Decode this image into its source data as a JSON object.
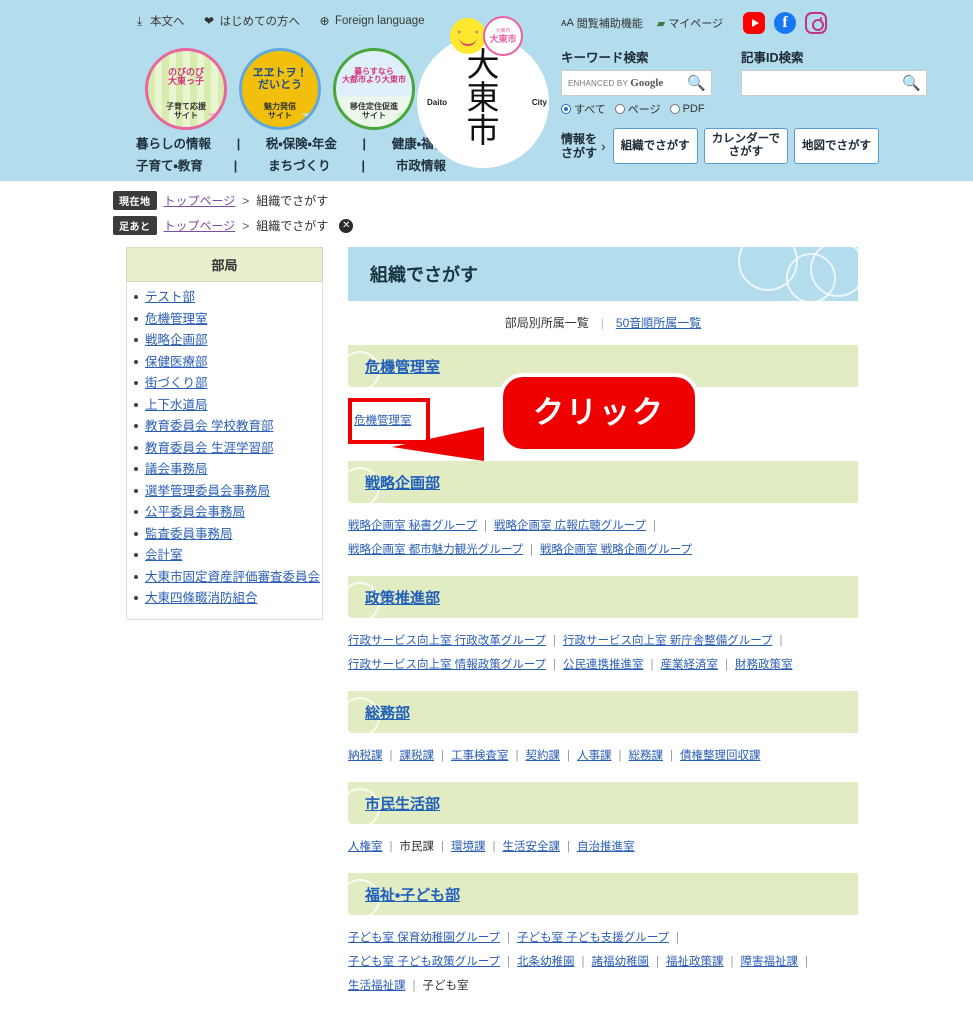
{
  "header": {
    "util_links": [
      {
        "icon": "download-icon",
        "glyph": "⤓",
        "label": "本文へ"
      },
      {
        "icon": "shield-icon",
        "glyph": "❤",
        "label": "はじめての方へ"
      },
      {
        "icon": "globe-icon",
        "glyph": "🌐",
        "label": "Foreign language"
      }
    ],
    "bubbles": [
      {
        "art": "のびのび\n大東っ子",
        "caption": "子育て応援\nサイト",
        "art_line1": "のびのび",
        "art_line2": "大東っ子",
        "cap_line1": "子育て応援",
        "cap_line2": "サイト"
      },
      {
        "art_line1": "ヱヱトヲ！",
        "art_line2": "だいとう",
        "cap_line1": "魅力発信",
        "cap_line2": "サイト"
      },
      {
        "art_line1": "暮らすなら",
        "art_line2": "大都市より大東市",
        "cap_line1": "移住定住促進",
        "cap_line2": "サイト"
      }
    ],
    "globalnav": [
      "暮らしの情報",
      "税・保険・年金",
      "健康・福祉",
      "子育て・教育",
      "まちづくり",
      "市政情報"
    ],
    "logo": {
      "kanji": [
        "大",
        "東",
        "市"
      ],
      "left_label": "Daito",
      "right_label": "City",
      "badge_small_line1": "大東市",
      "badge_small_line2": "大東市"
    },
    "right_util": [
      {
        "icon": "font-size-icon",
        "glyph": "ᴀA",
        "label": "閲覧補助機能"
      },
      {
        "icon": "folder-icon",
        "glyph": "🗀",
        "label": "マイページ"
      }
    ],
    "sns": [
      {
        "icon": "youtube-icon",
        "label": "YouTube"
      },
      {
        "icon": "facebook-icon",
        "label": "Facebook"
      },
      {
        "icon": "instagram-icon",
        "label": "Instagram"
      }
    ],
    "keyword_search": {
      "label": "キーワード検索",
      "value": "",
      "placeholder": "",
      "branding": "ENHANCED BY",
      "brand": "Google",
      "radios": [
        {
          "label": "すべて",
          "selected": true
        },
        {
          "label": "ページ",
          "selected": false
        },
        {
          "label": "PDF",
          "selected": false
        }
      ]
    },
    "article_search": {
      "label": "記事ID検索",
      "value": "",
      "placeholder": ""
    },
    "find": {
      "label_line1": "情報を",
      "label_line2": "さがす",
      "chevron": "›",
      "buttons": [
        {
          "line1": "組織でさがす",
          "line2": ""
        },
        {
          "line1": "カレンダーで",
          "line2": "さがす"
        },
        {
          "line1": "地図でさがす",
          "line2": ""
        }
      ]
    }
  },
  "breadcrumb": {
    "rows": [
      {
        "tag": "現在地",
        "link": "トップページ",
        "sep": ">",
        "current": "組織でさがす",
        "has_close": false
      },
      {
        "tag": "足あと",
        "link": "トップページ",
        "sep": ">",
        "current": "組織でさがす",
        "has_close": true
      }
    ],
    "close_glyph": "✕"
  },
  "sidebar": {
    "heading": "部局",
    "items": [
      "テスト部",
      "危機管理室",
      "戦略企画部",
      "保健医療部",
      "街づくり部",
      "上下水道局",
      "教育委員会 学校教育部",
      "教育委員会 生涯学習部",
      "議会事務局",
      "選挙管理委員会事務局",
      "公平委員会事務局",
      "監査委員事務局",
      "会計室",
      "大東市固定資産評価審査委員会",
      "大東四條畷消防組合"
    ]
  },
  "main": {
    "page_title": "組織でさがす",
    "tabs": [
      {
        "label": "部局別所属一覧",
        "active": true
      },
      {
        "label": "50音順所属一覧",
        "active": false
      }
    ],
    "tab_divider": "|",
    "departments": [
      {
        "name": "危機管理室",
        "highlight": true,
        "links": [
          {
            "label": "危機管理室",
            "link": true
          }
        ]
      },
      {
        "name": "戦略企画部",
        "highlight": false,
        "links": [
          {
            "label": "戦略企画室 秘書グループ",
            "link": true
          },
          {
            "label": "戦略企画室 広報広聴グループ",
            "link": true
          },
          {
            "label": "戦略企画室 都市魅力観光グループ",
            "link": true
          },
          {
            "label": "戦略企画室 戦略企画グループ",
            "link": true
          }
        ]
      },
      {
        "name": "政策推進部",
        "highlight": false,
        "links": [
          {
            "label": "行政サービス向上室 行政改革グループ",
            "link": true
          },
          {
            "label": "行政サービス向上室 新庁舎整備グループ",
            "link": true
          },
          {
            "label": "行政サービス向上室 情報政策グループ",
            "link": true
          },
          {
            "label": "公民連携推進室",
            "link": true
          },
          {
            "label": "産業経済室",
            "link": true
          },
          {
            "label": "財務政策室",
            "link": true
          }
        ]
      },
      {
        "name": "総務部",
        "highlight": false,
        "links": [
          {
            "label": "納税課",
            "link": true
          },
          {
            "label": "課税課",
            "link": true
          },
          {
            "label": "工事検査室",
            "link": true
          },
          {
            "label": "契約課",
            "link": true
          },
          {
            "label": "人事課",
            "link": true
          },
          {
            "label": "総務課",
            "link": true
          },
          {
            "label": "債権整理回収課",
            "link": true
          }
        ]
      },
      {
        "name": "市民生活部",
        "highlight": false,
        "links": [
          {
            "label": "人権室",
            "link": true
          },
          {
            "label": "市民課",
            "link": false
          },
          {
            "label": "環境課",
            "link": true
          },
          {
            "label": "生活安全課",
            "link": true
          },
          {
            "label": "自治推進室",
            "link": true
          }
        ]
      },
      {
        "name": "福祉・子ども部",
        "highlight": false,
        "links": [
          {
            "label": "子ども室 保育幼稚園グループ",
            "link": true
          },
          {
            "label": "子ども室 子ども支援グループ",
            "link": true
          },
          {
            "label": "子ども室 子ども政策グループ",
            "link": true
          },
          {
            "label": "北条幼稚園",
            "link": true
          },
          {
            "label": "諸福幼稚園",
            "link": true
          },
          {
            "label": "福祉政策課",
            "link": true
          },
          {
            "label": "障害福祉課",
            "link": true
          },
          {
            "label": "生活福祉課",
            "link": true
          },
          {
            "label": "子ども室",
            "link": false
          }
        ]
      }
    ]
  },
  "annotation": {
    "callout_text": "クリック",
    "callout_color": "#ee0000",
    "target": "危機管理室"
  },
  "colors": {
    "header_blue": "#b3dcec",
    "dept_green": "#e2ecc2",
    "sidebar_green": "#e9eecf",
    "link_blue": "#2b5fb5",
    "callout_red": "#ee0000"
  }
}
